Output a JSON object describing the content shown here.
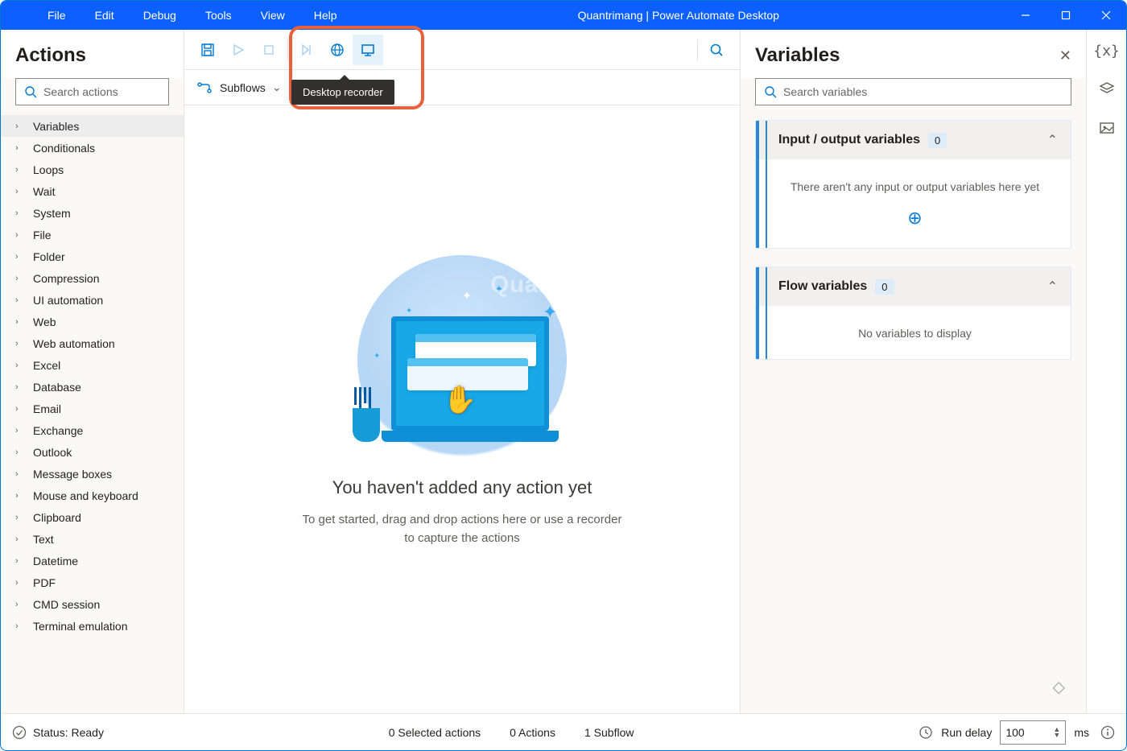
{
  "window": {
    "title": "Quantrimang | Power Automate Desktop"
  },
  "menubar": [
    "File",
    "Edit",
    "Debug",
    "Tools",
    "View",
    "Help"
  ],
  "actionsPanel": {
    "title": "Actions",
    "searchPlaceholder": "Search actions",
    "items": [
      "Variables",
      "Conditionals",
      "Loops",
      "Wait",
      "System",
      "File",
      "Folder",
      "Compression",
      "UI automation",
      "Web",
      "Web automation",
      "Excel",
      "Database",
      "Email",
      "Exchange",
      "Outlook",
      "Message boxes",
      "Mouse and keyboard",
      "Clipboard",
      "Text",
      "Datetime",
      "PDF",
      "CMD session",
      "Terminal emulation"
    ]
  },
  "toolbar": {
    "tooltip": "Desktop recorder"
  },
  "subflows": {
    "label": "Subflows"
  },
  "emptyState": {
    "title": "You haven't added any action yet",
    "subtitle": "To get started, drag and drop actions here or use a recorder to capture the actions"
  },
  "variablesPanel": {
    "title": "Variables",
    "searchPlaceholder": "Search variables",
    "io": {
      "label": "Input / output variables",
      "count": "0",
      "empty": "There aren't any input or output variables here yet"
    },
    "flow": {
      "label": "Flow variables",
      "count": "0",
      "empty": "No variables to display"
    }
  },
  "statusBar": {
    "status": "Status: Ready",
    "selected": "0 Selected actions",
    "actions": "0 Actions",
    "subflow": "1 Subflow",
    "runDelayLabel": "Run delay",
    "runDelayValue": "100",
    "runDelayUnit": "ms"
  },
  "watermark": "Quantrimang"
}
